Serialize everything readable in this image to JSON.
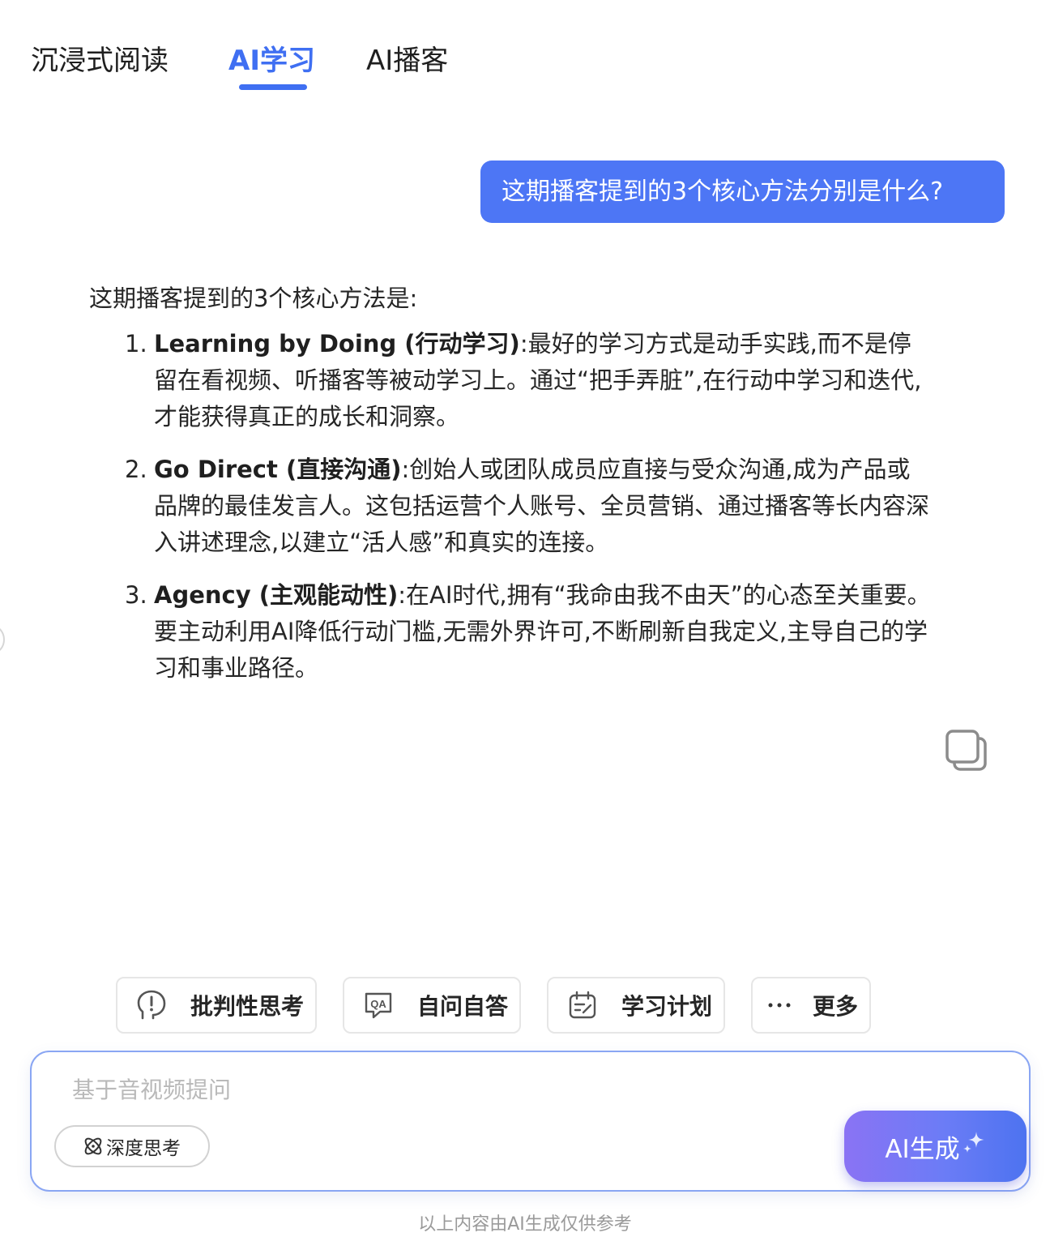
{
  "tabs": [
    {
      "label": "沉浸式阅读",
      "active": false
    },
    {
      "label": "AI学习",
      "active": true
    },
    {
      "label": "AI播客",
      "active": false
    }
  ],
  "accent_color": "#3f6ff2",
  "user_message": "这期播客提到的3个核心方法分别是什么?",
  "answer": {
    "intro": "这期播客提到的3个核心方法是:",
    "items": [
      {
        "number": "1.",
        "term": "Learning by Doing (行动学习)",
        "text": ":最好的学习方式是动手实践,而不是停留在看视频、听播客等被动学习上。通过“把手弄脏”,在行动中学习和迭代,才能获得真正的成长和洞察。"
      },
      {
        "number": "2.",
        "term": "Go Direct (直接沟通)",
        "text": ":创始人或团队成员应直接与受众沟通,成为产品或品牌的最佳发言人。这包括运营个人账号、全员营销、通过播客等长内容深入讲述理念,以建立“活人感”和真实的连接。"
      },
      {
        "number": "3.",
        "term": "Agency (主观能动性)",
        "text": ":在AI时代,拥有“我命由我不由天”的心态至关重要。要主动利用AI降低行动门槛,无需外界许可,不断刷新自我定义,主导自己的学习和事业路径。"
      }
    ]
  },
  "quick_actions": [
    {
      "label": "批判性思考",
      "icon": "head-exclamation-icon"
    },
    {
      "label": "自问自答",
      "icon": "qa-bubble-icon"
    },
    {
      "label": "学习计划",
      "icon": "calendar-plan-icon"
    },
    {
      "label": "更多",
      "icon": "more-dots-icon"
    }
  ],
  "input": {
    "placeholder": "基于音视频提问",
    "value": ""
  },
  "deep_think_label": "深度思考",
  "generate_label": "AI生成",
  "disclaimer": "以上内容由AI生成仅供参考"
}
